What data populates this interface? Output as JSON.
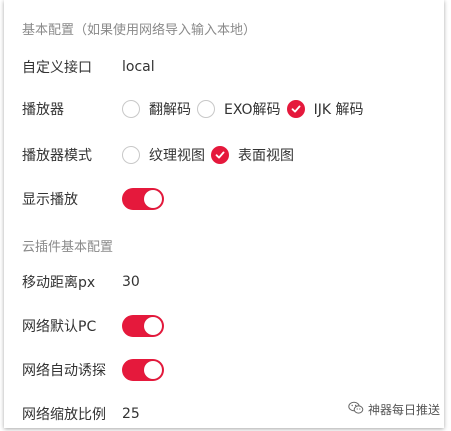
{
  "sections": {
    "basic_title": "基本配置（如果使用网络导入输入本地）",
    "plugin_title": "云插件基本配置"
  },
  "rows": {
    "custom_api": {
      "label": "自定义接口",
      "value": "local"
    },
    "player": {
      "label": "播放器",
      "options": [
        {
          "label": "翻解码",
          "checked": false
        },
        {
          "label": "EXO解码",
          "checked": false
        },
        {
          "label": "IJK 解码",
          "checked": true
        }
      ]
    },
    "player_mode": {
      "label": "播放器模式",
      "options": [
        {
          "label": "纹理视图",
          "checked": false
        },
        {
          "label": "表面视图",
          "checked": true
        }
      ]
    },
    "show_play": {
      "label": "显示播放",
      "on": true
    },
    "move_distance": {
      "label": "移动距离px",
      "value": "30"
    },
    "network_default_pc": {
      "label": "网络默认PC",
      "on": true
    },
    "network_auto_probe": {
      "label": "网络自动诱探",
      "on": true
    },
    "network_zoom": {
      "label": "网络缩放比例",
      "value": "25"
    }
  },
  "watermark": {
    "icon": "wechat-icon",
    "text": "神器每日推送"
  },
  "colors": {
    "accent": "#e5193c",
    "section_title": "#8a8a8a",
    "text": "#333333"
  }
}
